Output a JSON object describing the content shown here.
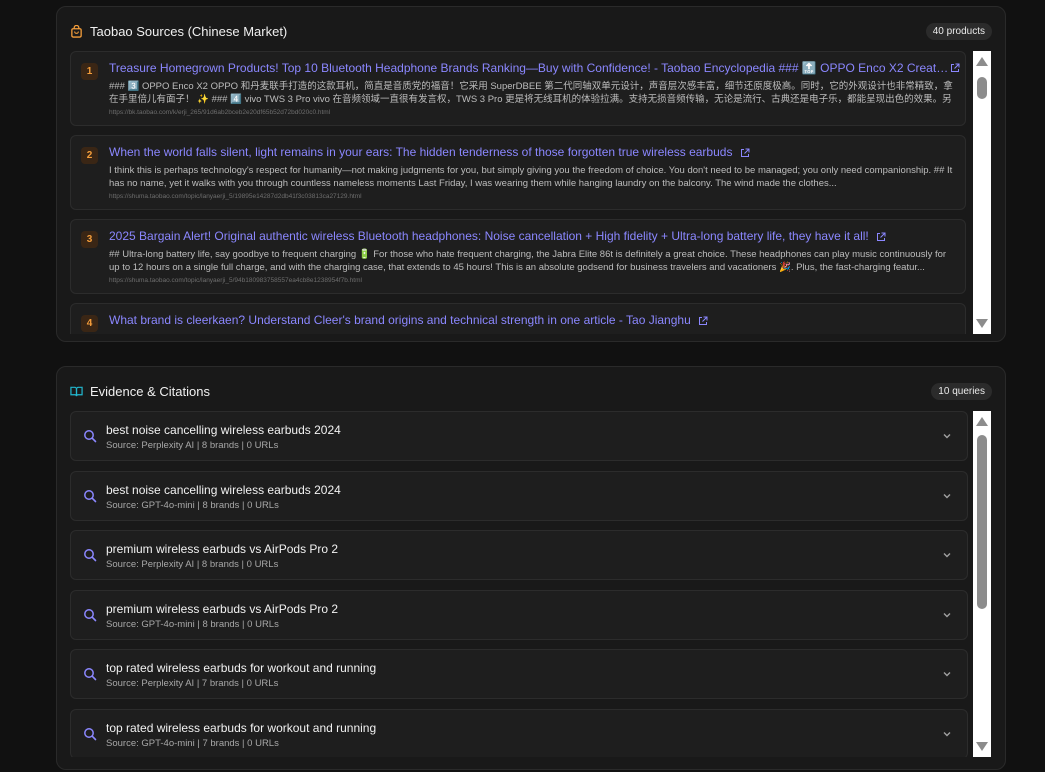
{
  "taobao": {
    "title": "Taobao Sources (Chinese Market)",
    "badge": "40 products",
    "items": [
      {
        "rank": "1",
        "title": "Treasure Homegrown Products! Top 10 Bluetooth Headphone Brands Ranking—Buy with Confidence! - Taobao Encyclopedia ### 🔝 OPPO Enco X2 Created through ...",
        "desc": "### 3️⃣ OPPO Enco X2 OPPO 和丹麦联手打造的这款耳机，简直是音质党的福音！它采用 SuperDBEE 第二代同轴双单元设计，声音层次感丰富，细节还原度极高。同时，它的外观设计也非常精致，拿在手里倍儿有面子！ ✨ ### 4️⃣ vivo TWS 3 Pro vivo 在音频领域一直很有发言权，TWS 3 Pro 更是将无线耳机的体验拉满。支持无损音频传输，无论是流行、古典还是电子乐，都能呈现出色的效果。另外，...",
        "url": "https://bk.taobao.com/k/erji_265/91d6ab2bceb2e20df65b52d72bd020c0.html"
      },
      {
        "rank": "2",
        "title": "When the world falls silent, light remains in your ears: The hidden tenderness of those forgotten true wireless earbuds",
        "desc": "I think this is perhaps technology's respect for humanity—not making judgments for you, but simply giving you the freedom of choice. You don't need to be managed; you only need companionship. ## It has no name, yet it walks with you through countless nameless moments Last Friday, I was wearing them while hanging laundry on the balcony. The wind made the clothes...",
        "url": "https://shuma.taobao.com/topic/lanyaerji_5/19895e14287d2db41f3c03813ca27129.html"
      },
      {
        "rank": "3",
        "title": "2025 Bargain Alert! Original authentic wireless Bluetooth headphones: Noise cancellation + High fidelity + Ultra-long battery life, they have it all!",
        "desc": "## Ultra-long battery life, say goodbye to frequent charging 🔋 For those who hate frequent charging, the Jabra Elite 86t is definitely a great choice. These headphones can play music continuously for up to 12 hours on a single full charge, and with the charging case, that extends to 45 hours! This is an absolute godsend for business travelers and vacationers 🎉. Plus, the fast-charging featur...",
        "url": "https://shuma.taobao.com/topic/lanyaerji_5/94b180983758557ea4cb8e1238954f7b.html"
      },
      {
        "rank": "4",
        "title": "What brand is cleerkaen? Understand Cleer's brand origins and technical strength in one article - Tao Jianghu",
        "desc": "",
        "url": ""
      }
    ]
  },
  "evidence": {
    "title": "Evidence & Citations",
    "badge": "10 queries",
    "queries": [
      {
        "text": "best noise cancelling wireless earbuds 2024",
        "meta": "Source: Perplexity AI | 8 brands | 0 URLs"
      },
      {
        "text": "best noise cancelling wireless earbuds 2024",
        "meta": "Source: GPT-4o-mini | 8 brands | 0 URLs"
      },
      {
        "text": "premium wireless earbuds vs AirPods Pro 2",
        "meta": "Source: Perplexity AI | 8 brands | 0 URLs"
      },
      {
        "text": "premium wireless earbuds vs AirPods Pro 2",
        "meta": "Source: GPT-4o-mini | 8 brands | 0 URLs"
      },
      {
        "text": "top rated wireless earbuds for workout and running",
        "meta": "Source: Perplexity AI | 7 brands | 0 URLs"
      },
      {
        "text": "top rated wireless earbuds for workout and running",
        "meta": "Source: GPT-4o-mini | 7 brands | 0 URLs"
      }
    ]
  },
  "colors": {
    "accent": "#8b87ff",
    "rank_bg": "#3a2615",
    "rank_text": "#f59e3b",
    "panel_bg": "#191919",
    "page_bg": "#111111"
  },
  "icons": {
    "taobao_header": "shopping-bag-icon",
    "evidence_header": "book-open-icon",
    "query": "search-icon",
    "row_toggle": "chevron-down-icon",
    "external": "external-link-icon"
  }
}
